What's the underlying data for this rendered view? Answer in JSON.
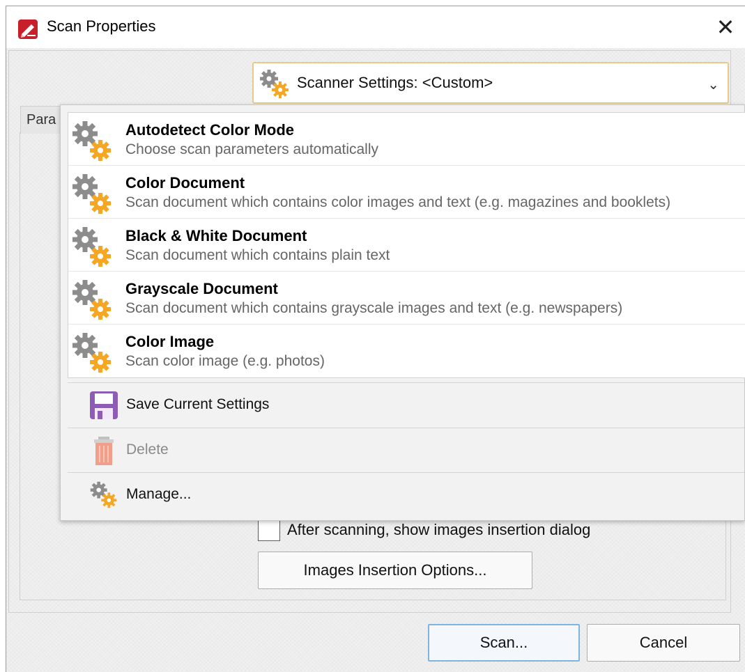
{
  "window": {
    "title": "Scan Properties",
    "close_symbol": "✕",
    "app_icon": "pdf-xchange-icon"
  },
  "tab": {
    "label_partial": "Para"
  },
  "scanner_settings": {
    "label": "Scanner Settings:  <Custom>",
    "icon": "gears-icon",
    "chevron": "⌄"
  },
  "dropdown": {
    "presets": [
      {
        "name": "Autodetect Color Mode",
        "description": "Choose scan parameters automatically"
      },
      {
        "name": "Color Document",
        "description": "Scan document which contains color images and text (e.g. magazines and booklets)"
      },
      {
        "name": "Black & White Document",
        "description": "Scan document which contains plain text"
      },
      {
        "name": "Grayscale Document",
        "description": "Scan document which contains grayscale images and text (e.g. newspapers)"
      },
      {
        "name": "Color Image",
        "description": "Scan color image (e.g. photos)"
      }
    ],
    "commands": [
      {
        "label": "Save Current Settings",
        "icon": "save-icon",
        "enabled": true
      },
      {
        "label": "Delete",
        "icon": "trash-icon",
        "enabled": false
      },
      {
        "label": "Manage...",
        "icon": "gears-icon",
        "enabled": true
      }
    ]
  },
  "options": {
    "show_insertion_dialog_label": "After scanning, show images insertion dialog",
    "show_insertion_dialog_checked": false,
    "insertion_options_button": "Images Insertion Options..."
  },
  "footer": {
    "scan_button": "Scan...",
    "cancel_button": "Cancel"
  },
  "colors": {
    "gear_gray": "#8c8c8c",
    "gear_orange": "#f5a623",
    "save_purple": "#8e5bb5",
    "trash_salmon": "#f0a08a",
    "focus_blue": "#7fb3e0"
  }
}
